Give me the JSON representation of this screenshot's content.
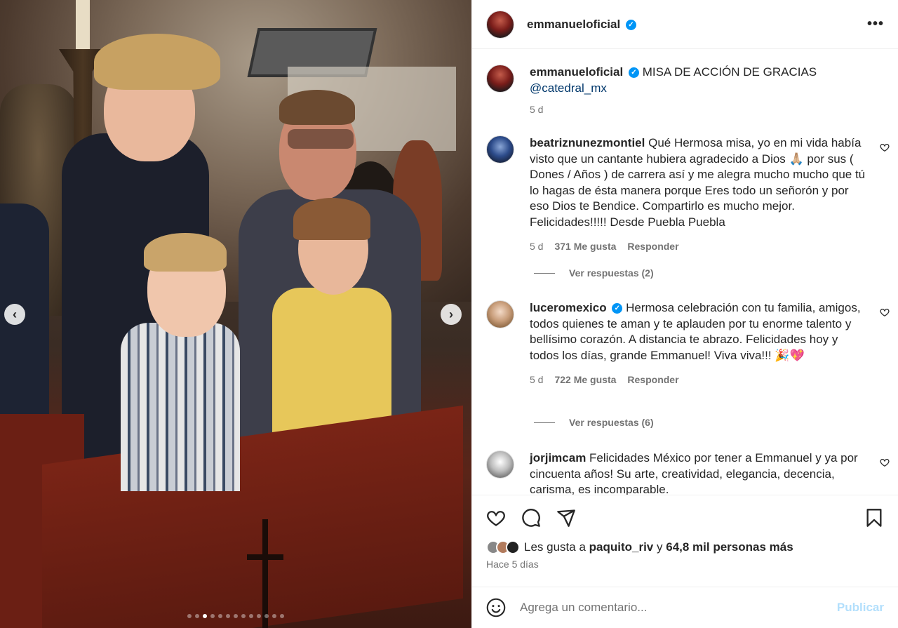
{
  "media": {
    "prev_glyph": "‹",
    "next_glyph": "›",
    "dots_total": 13,
    "active_dot": 2
  },
  "header": {
    "username": "emmanueloficial",
    "verified_glyph": "✓",
    "more_glyph": "•••"
  },
  "caption": {
    "username": "emmanueloficial",
    "text": "MISA DE ACCIÓN DE GRACIAS",
    "mention": "@catedral_mx",
    "time": "5 d"
  },
  "comments": [
    {
      "username": "beatriznunezmontiel",
      "verified": false,
      "text": "Qué Hermosa misa, yo en mi vida había visto que un cantante hubiera agradecido a Dios 🙏🏼 por sus ( Dones / Años ) de carrera así y me alegra mucho mucho que tú lo hagas de ésta manera porque Eres todo un señorón y por eso Dios te Bendice. Compartirlo es mucho mejor. Felicidades!!!!! Desde Puebla Puebla",
      "time": "5 d",
      "likes": "371 Me gusta",
      "reply": "Responder",
      "replies": "Ver respuestas (2)"
    },
    {
      "username": "luceromexico",
      "verified": true,
      "text": "Hermosa celebración con tu familia, amigos, todos quienes te aman y te aplauden por tu enorme talento y bellísimo corazón. A distancia te abrazo. Felicidades hoy y todos los días, grande Emmanuel! Viva viva!!! 🎉💖",
      "time": "5 d",
      "likes": "722 Me gusta",
      "reply": "Responder",
      "replies": "Ver respuestas (6)"
    },
    {
      "username": "jorjimcam",
      "verified": false,
      "text": "Felicidades México por tener a Emmanuel y ya por cincuenta años! Su arte, creatividad, elegancia, decencia, carisma, es incomparable."
    }
  ],
  "likes": {
    "prefix": "Les gusta a",
    "user": "paquito_riv",
    "joiner": "y",
    "rest": "64,8 mil personas más",
    "ago": "Hace 5 días"
  },
  "composer": {
    "placeholder": "Agrega un comentario...",
    "publish": "Publicar"
  },
  "colors": {
    "verified": "#0095f6",
    "publish_disabled": "#b2dffc",
    "secondary_text": "#737373",
    "mention": "#00376b"
  }
}
